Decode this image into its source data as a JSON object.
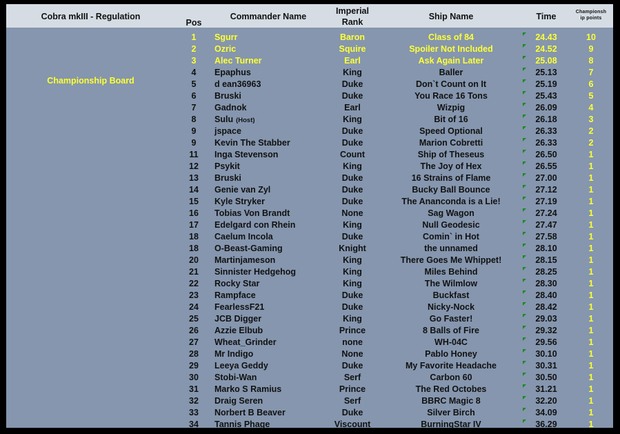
{
  "board": {
    "title": "Cobra mkIII - Regulation",
    "label": "Championship Board"
  },
  "columns": {
    "pos": "Pos",
    "name": "Commander Name",
    "rank_line1": "Imperial",
    "rank_line2": "Rank",
    "ship": "Ship Name",
    "time": "Time",
    "points_line1": "Championsh",
    "points_line2": "ip points"
  },
  "colors": {
    "panel_bg": "#8596ae",
    "header_bg": "#d5dce4",
    "highlight_text": "#ffff33",
    "normal_text": "#111111",
    "note_marker": "#1a8a1a"
  },
  "rows": [
    {
      "pos": "1",
      "name": "Sgurr",
      "rank": "Baron",
      "ship": "Class of 84",
      "time": "24.43",
      "points": "10",
      "top": true
    },
    {
      "pos": "2",
      "name": "Ozric",
      "rank": "Squire",
      "ship": "Spoiler Not Included",
      "time": "24.52",
      "points": "9",
      "top": true
    },
    {
      "pos": "3",
      "name": "Alec Turner",
      "rank": "Earl",
      "ship": "Ask Again Later",
      "time": "25.08",
      "points": "8",
      "top": true
    },
    {
      "pos": "4",
      "name": "Epaphus",
      "rank": "King",
      "ship": "Baller",
      "time": "25.13",
      "points": "7"
    },
    {
      "pos": "5",
      "name": "d ean36963",
      "rank": "Duke",
      "ship": "Don`t Count on It",
      "time": "25.19",
      "points": "6"
    },
    {
      "pos": "6",
      "name": "Bruski",
      "rank": "Duke",
      "ship": "You Race 16 Tons",
      "time": "25.43",
      "points": "5"
    },
    {
      "pos": "7",
      "name": "Gadnok",
      "rank": "Earl",
      "ship": "Wizpig",
      "time": "26.09",
      "points": "4"
    },
    {
      "pos": "8",
      "name": "Sulu",
      "name_suffix": "(Host)",
      "rank": "King",
      "ship": "Bit of 16",
      "time": "26.18",
      "points": "3"
    },
    {
      "pos": "9",
      "name": "jspace",
      "rank": "Duke",
      "ship": "Speed Optional",
      "time": "26.33",
      "points": "2"
    },
    {
      "pos": "9",
      "name": "Kevin The Stabber",
      "rank": "Duke",
      "ship": "Marion Cobretti",
      "time": "26.33",
      "points": "2"
    },
    {
      "pos": "11",
      "name": "Inga Stevenson",
      "rank": "Count",
      "ship": "Ship of Theseus",
      "time": "26.50",
      "points": "1"
    },
    {
      "pos": "12",
      "name": "Psykit",
      "rank": "King",
      "ship": "The Joy of Hex",
      "time": "26.55",
      "points": "1"
    },
    {
      "pos": "13",
      "name": "Bruski",
      "rank": "Duke",
      "ship": "16 Strains of Flame",
      "time": "27.00",
      "points": "1"
    },
    {
      "pos": "14",
      "name": "Genie van Zyl",
      "rank": "Duke",
      "ship": "Bucky Ball Bounce",
      "time": "27.12",
      "points": "1"
    },
    {
      "pos": "15",
      "name": "Kyle Stryker",
      "rank": "Duke",
      "ship": "The Ananconda is a Lie!",
      "time": "27.19",
      "points": "1"
    },
    {
      "pos": "16",
      "name": "Tobias Von Brandt",
      "rank": "None",
      "ship": "Sag Wagon",
      "time": "27.24",
      "points": "1"
    },
    {
      "pos": "17",
      "name": "Edelgard con Rhein",
      "rank": "King",
      "ship": "Null Geodesic",
      "time": "27.47",
      "points": "1"
    },
    {
      "pos": "18",
      "name": "Caelum Incola",
      "rank": "Duke",
      "ship": "Comin` in Hot",
      "time": "27.58",
      "points": "1"
    },
    {
      "pos": "18",
      "name": "O-Beast-Gaming",
      "rank": "Knight",
      "ship": "the unnamed",
      "time": "28.10",
      "points": "1"
    },
    {
      "pos": "20",
      "name": "Martinjameson",
      "rank": "King",
      "ship": "There Goes Me Whippet!",
      "time": "28.15",
      "points": "1"
    },
    {
      "pos": "21",
      "name": "Sinnister Hedgehog",
      "rank": "King",
      "ship": "Miles Behind",
      "time": "28.25",
      "points": "1"
    },
    {
      "pos": "22",
      "name": "Rocky Star",
      "rank": "King",
      "ship": "The Wilmlow",
      "time": "28.30",
      "points": "1"
    },
    {
      "pos": "23",
      "name": "Rampface",
      "rank": "Duke",
      "ship": "Buckfast",
      "time": "28.40",
      "points": "1"
    },
    {
      "pos": "24",
      "name": "FearlessF21",
      "rank": "Duke",
      "ship": "Nicky-Nock",
      "time": "28.42",
      "points": "1"
    },
    {
      "pos": "25",
      "name": "JCB Digger",
      "rank": "King",
      "ship": "Go Faster!",
      "time": "29.03",
      "points": "1"
    },
    {
      "pos": "26",
      "name": "Azzie Elbub",
      "rank": "Prince",
      "ship": "8 Balls of Fire",
      "time": "29.32",
      "points": "1"
    },
    {
      "pos": "27",
      "name": "Wheat_Grinder",
      "rank": "none",
      "ship": "WH-04C",
      "time": "29.56",
      "points": "1"
    },
    {
      "pos": "28",
      "name": "Mr Indigo",
      "rank": "None",
      "ship": "Pablo Honey",
      "time": "30.10",
      "points": "1"
    },
    {
      "pos": "29",
      "name": "Leeya Geddy",
      "rank": "Duke",
      "ship": "My Favorite Headache",
      "time": "30.31",
      "points": "1"
    },
    {
      "pos": "30",
      "name": "Stobi-Wan",
      "rank": "Serf",
      "ship": "Carbon 60",
      "time": "30.50",
      "points": "1"
    },
    {
      "pos": "31",
      "name": "Marko S Ramius",
      "rank": "Prince",
      "ship": "The Red Octobes",
      "time": "31.21",
      "points": "1"
    },
    {
      "pos": "32",
      "name": "Draig Seren",
      "rank": "Serf",
      "ship": "BBRC Magic 8",
      "time": "32.20",
      "points": "1"
    },
    {
      "pos": "33",
      "name": "Norbert B Beaver",
      "rank": "Duke",
      "ship": "Silver Birch",
      "time": "34.09",
      "points": "1"
    },
    {
      "pos": "34",
      "name": "Tannis Phage",
      "rank": "Viscount",
      "ship": "BurningStar IV",
      "time": "36.29",
      "points": "1"
    }
  ]
}
